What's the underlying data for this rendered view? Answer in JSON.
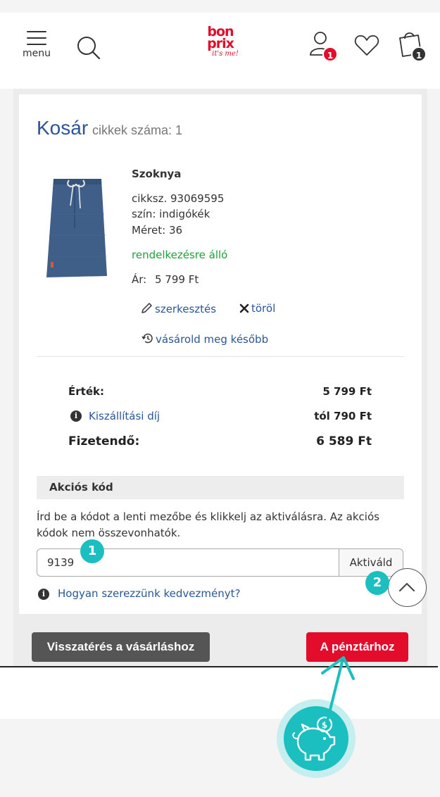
{
  "header": {
    "menu_label": "menu",
    "logo": {
      "line1": "bon",
      "line2": "prix",
      "line3": "it's me!"
    },
    "account_badge": "1",
    "bag_badge": "1"
  },
  "cart": {
    "title": "Kosár",
    "count_label": "cikkek száma: 1"
  },
  "product": {
    "name": "Szoknya",
    "sku": "cikksz. 93069595",
    "color": "szín: indigókék",
    "size": "Méret: 36",
    "availability": "rendelkezésre álló",
    "price_label": "Ár:",
    "price_value": "5 799 Ft",
    "actions": {
      "edit": "szerkesztés",
      "delete": "töröl",
      "buy_later": "vásárold meg később"
    }
  },
  "summary": {
    "value_label": "Érték:",
    "value": "5 799 Ft",
    "shipping_label": "Kiszállítási díj",
    "shipping_value": "tól 790 Ft",
    "total_label": "Fizetendő:",
    "total_value": "6 589 Ft"
  },
  "promo": {
    "heading": "Akciós kód",
    "info": "Írd be a kódot a lenti mezőbe és klikkelj az aktiválásra. Az akciós kódok nem összevonhatók.",
    "input_value": "9139",
    "button_label": "Aktiváld",
    "help_link": "Hogyan szerezzünk kedvezményt?"
  },
  "annotations": {
    "step1": "1",
    "step2": "2"
  },
  "buttons": {
    "back": "Visszatérés a vásárláshoz",
    "checkout": "A pénztárhoz"
  },
  "colors": {
    "brand_red": "#e30d2b",
    "link_blue": "#2a5699",
    "available_green": "#1ea13d",
    "annotation_teal": "#1bbfc0"
  },
  "icons": [
    "menu-icon",
    "search-icon",
    "account-icon",
    "heart-icon",
    "bag-icon",
    "pencil-icon",
    "close-icon",
    "history-icon",
    "info-icon",
    "chevron-up-icon",
    "piggy-bank-icon"
  ]
}
